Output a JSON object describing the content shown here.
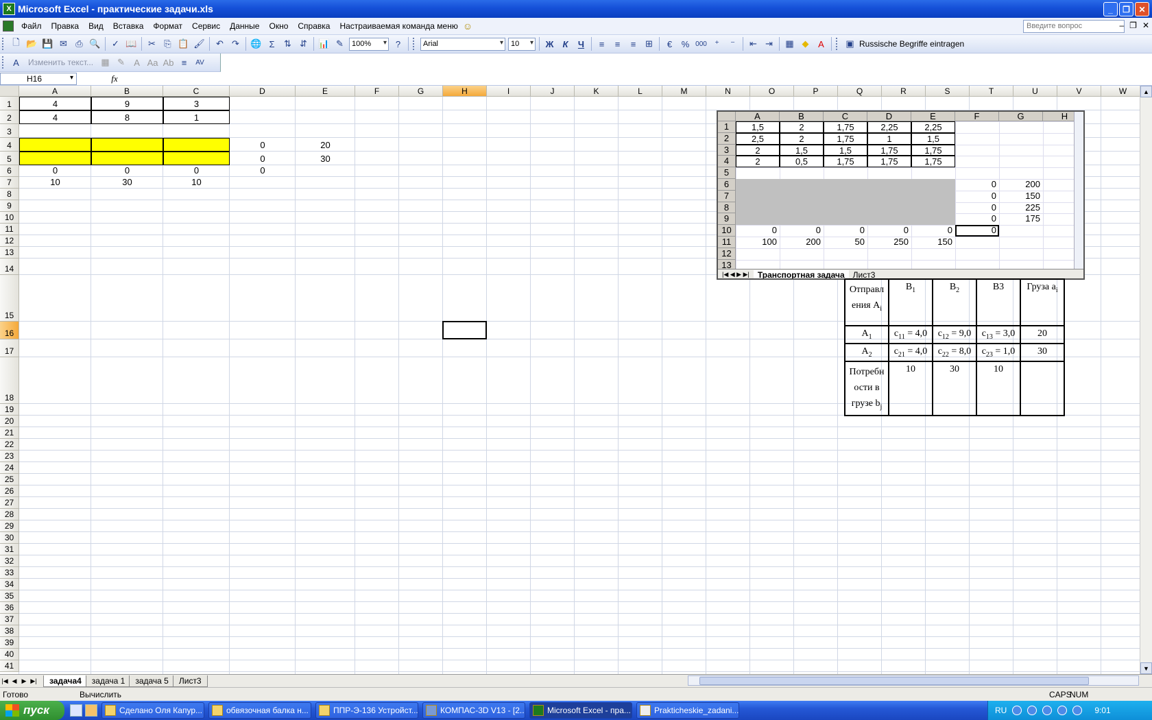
{
  "window": {
    "title": "Microsoft Excel - практические задачи.xls"
  },
  "menu": {
    "items": [
      "Файл",
      "Правка",
      "Вид",
      "Вставка",
      "Формат",
      "Сервис",
      "Данные",
      "Окно",
      "Справка",
      "Настраиваемая команда меню"
    ],
    "help_placeholder": "Введите вопрос"
  },
  "toolbar": {
    "zoom": "100%",
    "font": "Arial",
    "font_size": "10",
    "bold": "Ж",
    "italic": "К",
    "underline": "Ч",
    "percent": "%",
    "thousands": "000",
    "macro_label": "Russische Begriffe eintragen",
    "edit_text": "Изменить текст..."
  },
  "formula_bar": {
    "name_box": "H16",
    "fx": "fx",
    "formula": ""
  },
  "sheet": {
    "columns": [
      "A",
      "B",
      "C",
      "D",
      "E",
      "F",
      "G",
      "H",
      "I",
      "J",
      "K",
      "L",
      "M",
      "N",
      "O",
      "P",
      "Q",
      "R",
      "S",
      "T",
      "U",
      "V",
      "W"
    ],
    "selected_column": "H",
    "selected_row": "16",
    "rows": [
      "1",
      "2",
      "3",
      "4",
      "5",
      "6",
      "7",
      "8",
      "9",
      "10",
      "11",
      "12",
      "13",
      "14",
      "15",
      "16",
      "17",
      "18",
      "19",
      "20",
      "21",
      "22",
      "23",
      "24",
      "25",
      "26",
      "27",
      "28",
      "29",
      "30",
      "31",
      "32",
      "33",
      "34",
      "35",
      "36",
      "37",
      "38",
      "39",
      "40",
      "41"
    ],
    "cells": {
      "A1": "4",
      "B1": "9",
      "C1": "3",
      "A2": "4",
      "B2": "8",
      "C2": "1",
      "D4": "0",
      "E4": "20",
      "D5": "0",
      "E5": "30",
      "A6": "0",
      "B6": "0",
      "C6": "0",
      "D6": "0",
      "A7": "10",
      "B7": "30",
      "C7": "10"
    },
    "highlight_color": "#ffff00"
  },
  "embedded": {
    "columns": [
      "A",
      "B",
      "C",
      "D",
      "E",
      "F",
      "G",
      "H"
    ],
    "rows": [
      "1",
      "2",
      "3",
      "4",
      "5",
      "6",
      "7",
      "8",
      "9",
      "10",
      "11",
      "12",
      "13"
    ],
    "data": [
      [
        "1,5",
        "2",
        "1,75",
        "2,25",
        "2,25"
      ],
      [
        "2,5",
        "2",
        "1,75",
        "1",
        "1,5"
      ],
      [
        "2",
        "1,5",
        "1,5",
        "1,75",
        "1,75"
      ],
      [
        "2",
        "0,5",
        "1,75",
        "1,75",
        "1,75"
      ]
    ],
    "right_f": [
      "0",
      "0",
      "0",
      "0"
    ],
    "right_g": [
      "200",
      "150",
      "225",
      "175"
    ],
    "totals_row": [
      "0",
      "0",
      "0",
      "0",
      "0",
      "0"
    ],
    "demand_row": [
      "100",
      "200",
      "50",
      "250",
      "150"
    ],
    "tabs": [
      "Транспортная задача",
      "Лист3"
    ],
    "gray": "#c0c0c0"
  },
  "transport_table": {
    "h_sender": "Отправл ения A",
    "h_sender_sub": "i",
    "h_b1": "B",
    "h_b1_sub": "1",
    "h_b2": "B",
    "h_b2_sub": "2",
    "h_b3": "B3",
    "h_cargo": "Груза a",
    "h_cargo_sub": "i",
    "r1_label": "A",
    "r1_label_sub": "1",
    "r1_c1": "c",
    "r1_c1_sub": "11",
    "r1_c1_val": " = 4,0",
    "r1_c2": "c",
    "r1_c2_sub": "12",
    "r1_c2_val": " = 9,0",
    "r1_c3": "c",
    "r1_c3_sub": "13",
    "r1_c3_val": " = 3,0",
    "r1_a": "20",
    "r2_label": "A",
    "r2_label_sub": "2",
    "r2_c1": "c",
    "r2_c1_sub": "21",
    "r2_c1_val": " = 4,0",
    "r2_c2": "c",
    "r2_c2_sub": "22",
    "r2_c2_val": " = 8,0",
    "r2_c3": "c",
    "r2_c3_sub": "23",
    "r2_c3_val": " = 1,0",
    "r2_a": "30",
    "r3_label": "Потребн ости в грузе b",
    "r3_label_sub": "j",
    "r3_b1": "10",
    "r3_b2": "30",
    "r3_b3": "10"
  },
  "sheet_tabs": [
    "задача4",
    "задача 1",
    "задача 5",
    "Лист3"
  ],
  "status": {
    "ready": "Готово",
    "calc": "Вычислить",
    "caps": "CAPS",
    "num": "NUM"
  },
  "taskbar": {
    "start": "пуск",
    "tasks": [
      "Сделано Оля Капур...",
      "обвязочная балка н...",
      "ППР-Э-136 Устройст...",
      "КОМПАС-3D V13 - [2...",
      "Microsoft Excel - пра...",
      "Prakticheskie_zadani..."
    ],
    "lang": "RU",
    "clock": "9:01"
  }
}
